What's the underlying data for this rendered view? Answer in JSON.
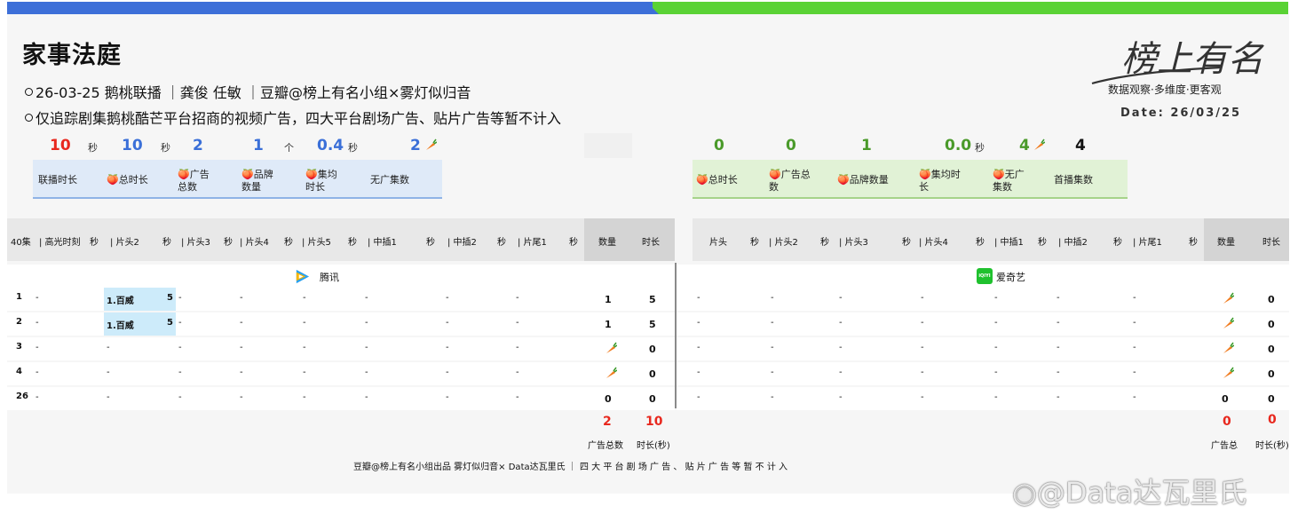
{
  "header": {
    "title": "家事法庭",
    "line1": "26-03-25 鹅桃联播 ｜龚俊 任敏 ｜豆瓣@榜上有名小组×雾灯似归音",
    "line2": "仅追踪剧集鹅桃酷芒平台招商的视频广告，四大平台剧场广告、贴片广告等暂不计入",
    "logo_text": "榜上有名",
    "logo_tagline": "数据观察·多维度·更客观",
    "date": "Date: 26/03/25"
  },
  "summary_left": {
    "values": [
      "10",
      "10",
      "2",
      "1",
      "0.4",
      "2"
    ],
    "units": [
      "秒",
      "秒",
      "个",
      "秒"
    ],
    "labels": [
      "联播时长",
      "总时长",
      "广告\n总数",
      "品牌\n数量",
      "集均\n时长",
      "无广集数"
    ]
  },
  "summary_right": {
    "values": [
      "0",
      "0",
      "1",
      "0.0",
      "4",
      "4"
    ],
    "units": [
      "秒"
    ],
    "labels": [
      "总时长",
      "广告总\n数",
      "品牌数量",
      "集均时\n长",
      "无广\n集数",
      "首播集数"
    ]
  },
  "table": {
    "left_headers": [
      "40集",
      "| 高光时刻",
      "秒",
      "| 片头2",
      "秒",
      "| 片头3",
      "秒",
      "| 片头4",
      "秒",
      "| 片头5",
      "秒",
      "| 中插1",
      "秒",
      "| 中插2",
      "秒",
      "| 片尾1",
      "秒",
      "数量",
      "时长"
    ],
    "right_headers": [
      "片头",
      "秒",
      "| 片头2",
      "秒",
      "| 片头3",
      "秒",
      "| 片头4",
      "秒",
      "| 中插1",
      "秒",
      "| 中插2",
      "秒",
      "| 片尾1",
      "秒",
      "数量",
      "时长"
    ],
    "left_platform": "腾讯",
    "right_platform": "爱奇艺",
    "rows": [
      {
        "ep": "1",
        "col1": "-",
        "ad": "1.百威",
        "sec": "5",
        "c4": "-",
        "c5": "-",
        "c6": "-",
        "c7": "-",
        "c8": "-",
        "c9": "-",
        "count": "1",
        "dur": "5",
        "r": [
          "-",
          "-",
          "-",
          "-",
          "-",
          "-",
          "-"
        ],
        "rcount": "carrot",
        "rdur": "0"
      },
      {
        "ep": "2",
        "col1": "-",
        "ad": "1.百威",
        "sec": "5",
        "c4": "-",
        "c5": "-",
        "c6": "-",
        "c7": "-",
        "c8": "-",
        "c9": "-",
        "count": "1",
        "dur": "5",
        "r": [
          "-",
          "-",
          "-",
          "-",
          "-",
          "-",
          "-"
        ],
        "rcount": "carrot",
        "rdur": "0"
      },
      {
        "ep": "3",
        "col1": "-",
        "ad": "-",
        "sec": "",
        "c4": "-",
        "c5": "-",
        "c6": "-",
        "c7": "-",
        "c8": "-",
        "c9": "-",
        "count": "carrot",
        "dur": "0",
        "r": [
          "-",
          "-",
          "-",
          "-",
          "-",
          "-",
          "-"
        ],
        "rcount": "carrot",
        "rdur": "0"
      },
      {
        "ep": "4",
        "col1": "-",
        "ad": "-",
        "sec": "",
        "c4": "-",
        "c5": "-",
        "c6": "-",
        "c7": "-",
        "c8": "-",
        "c9": "-",
        "count": "carrot",
        "dur": "0",
        "r": [
          "-",
          "-",
          "-",
          "-",
          "-",
          "-",
          "-"
        ],
        "rcount": "carrot",
        "rdur": "0"
      },
      {
        "ep": "26",
        "col1": "-",
        "ad": "-",
        "sec": "",
        "c4": "-",
        "c5": "-",
        "c6": "-",
        "c7": "-",
        "c8": "-",
        "c9": "-",
        "count": "0",
        "dur": "0",
        "r": [
          "-",
          "-",
          "-",
          "-",
          "-",
          "-",
          "-"
        ],
        "rcount": "0",
        "rdur": "0"
      }
    ]
  },
  "totals": {
    "left_count": "2",
    "left_dur": "10",
    "left_count_label": "广告总数",
    "left_dur_label": "时长(秒)",
    "right_count": "0",
    "right_dur": "0",
    "right_count_label": "广告总",
    "right_dur_label": "时长(秒)"
  },
  "footer": "豆瓣@榜上有名小组出品 雾灯似归音× Data达瓦里氏 ｜ 四 大 平 台 剧 场 广 告 、 贴 片 广 告 等 暂 不 计 入",
  "watermark": "@Data达瓦里氏",
  "colors": {
    "blue": "#3d6fd8",
    "green": "#5ad235",
    "red": "#e8281e",
    "value_blue": "#3a6fd8",
    "value_green": "#4a9a2a"
  }
}
